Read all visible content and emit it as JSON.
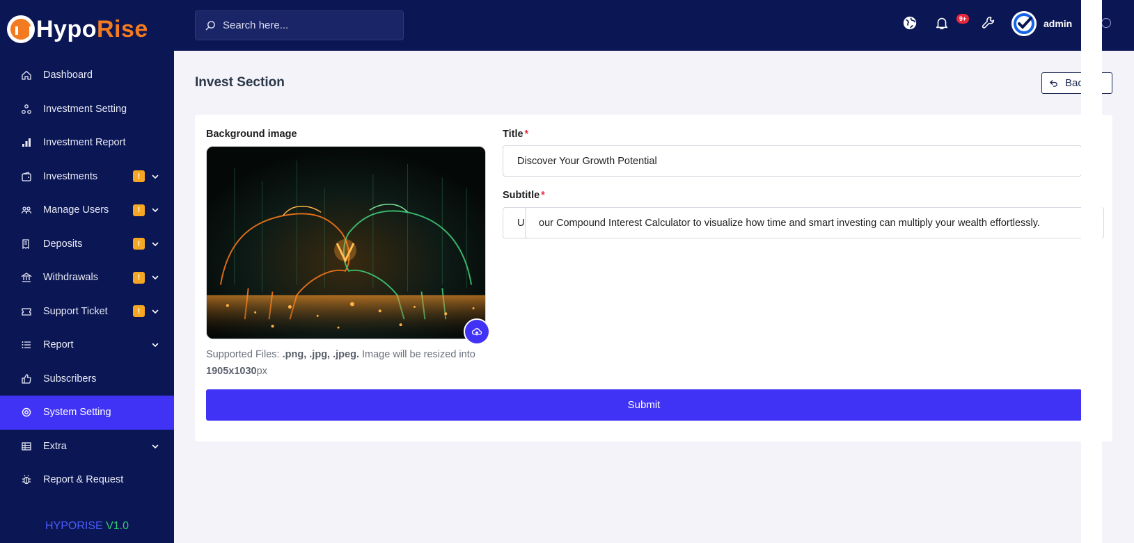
{
  "brand": {
    "name_white": "Hypo",
    "name_orange": "Rise",
    "version_name": "HYPORISE",
    "version_num": "V1.0"
  },
  "search": {
    "placeholder": "Search here..."
  },
  "header": {
    "notifications_badge": "9+",
    "admin_name": "admin"
  },
  "sidebar": {
    "items": [
      {
        "label": "Dashboard",
        "icon": "home-icon",
        "badge": "",
        "chevron": false,
        "active": false
      },
      {
        "label": "Investment Setting",
        "icon": "nodes-icon",
        "badge": "",
        "chevron": false,
        "active": false
      },
      {
        "label": "Investment Report",
        "icon": "bar-chart-icon",
        "badge": "",
        "chevron": false,
        "active": false
      },
      {
        "label": "Investments",
        "icon": "wallet-icon",
        "badge": "!",
        "chevron": true,
        "active": false
      },
      {
        "label": "Manage Users",
        "icon": "users-icon",
        "badge": "!",
        "chevron": true,
        "active": false
      },
      {
        "label": "Deposits",
        "icon": "receipt-icon",
        "badge": "!",
        "chevron": true,
        "active": false
      },
      {
        "label": "Withdrawals",
        "icon": "bank-icon",
        "badge": "!",
        "chevron": true,
        "active": false
      },
      {
        "label": "Support Ticket",
        "icon": "ticket-icon",
        "badge": "!",
        "chevron": true,
        "active": false
      },
      {
        "label": "Report",
        "icon": "list-icon",
        "badge": "",
        "chevron": true,
        "active": false
      },
      {
        "label": "Subscribers",
        "icon": "thumbs-up-icon",
        "badge": "",
        "chevron": false,
        "active": false
      },
      {
        "label": "System Setting",
        "icon": "settings-icon",
        "badge": "",
        "chevron": false,
        "active": true
      },
      {
        "label": "Extra",
        "icon": "table-icon",
        "badge": "",
        "chevron": true,
        "active": false
      },
      {
        "label": "Report & Request",
        "icon": "bug-icon",
        "badge": "",
        "chevron": false,
        "active": false
      }
    ]
  },
  "page": {
    "title": "Invest Section",
    "back_label": "Back"
  },
  "form": {
    "bg_label": "Background image",
    "help_prefix": "Supported Files: ",
    "help_types": ".png, .jpg, .jpeg.",
    "help_mid": " Image will be resized into ",
    "help_size": "1905x1030",
    "help_unit": "px",
    "title_label": "Title",
    "title_value": "Discover Your Growth Potential",
    "subtitle_label": "Subtitle",
    "subtitle_visible_prefix": "U",
    "subtitle_overlay_text": "our Compound Interest Calculator to visualize how time and smart investing can multiply your wealth effortlessly.",
    "required_mark": "*",
    "submit_label": "Submit"
  },
  "colors": {
    "sidebar_bg": "#0b1654",
    "accent": "#4033f5",
    "brand_orange": "#f27b21",
    "warn_badge": "#f5a623",
    "danger": "#e8283c"
  }
}
